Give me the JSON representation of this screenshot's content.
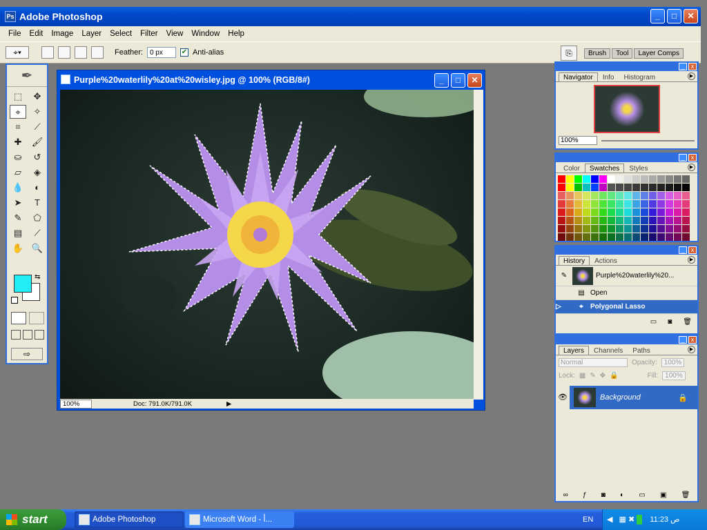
{
  "app": {
    "title": "Adobe Photoshop",
    "icon": "photoshop-icon"
  },
  "window_buttons": {
    "minimize": "_",
    "maximize": "□",
    "close": "✕"
  },
  "menu": [
    "File",
    "Edit",
    "Image",
    "Layer",
    "Select",
    "Filter",
    "View",
    "Window",
    "Help"
  ],
  "options": {
    "feather_label": "Feather:",
    "feather_value": "0 px",
    "antialias_label": "Anti-alias",
    "antialias_checked": true
  },
  "palette_well": [
    "Brush",
    "Tool",
    "Layer Comps"
  ],
  "document": {
    "title": "Purple%20waterlily%20at%20wisley.jpg @ 100% (RGB/8#)",
    "zoom": "100%",
    "doc_size": "Doc: 791.0K/791.0K"
  },
  "foreground_color": "#22ecf5",
  "navigator": {
    "tabs": [
      "Navigator",
      "Info",
      "Histogram"
    ],
    "zoom": "100%"
  },
  "color_panel": {
    "tabs": [
      "Color",
      "Swatches",
      "Styles"
    ]
  },
  "history": {
    "tabs": [
      "History",
      "Actions"
    ],
    "snapshot": "Purple%20waterlily%20...",
    "items": [
      "Open",
      "Polygonal Lasso"
    ]
  },
  "layers": {
    "tabs": [
      "Layers",
      "Channels",
      "Paths"
    ],
    "blend_mode": "Normal",
    "opacity_label": "Opacity:",
    "opacity_value": "100%",
    "lock_label": "Lock:",
    "fill_label": "Fill:",
    "fill_value": "100%",
    "layer_name": "Background"
  },
  "taskbar": {
    "start": "start",
    "tasks": [
      "Adobe Photoshop",
      "Microsoft Word - أ..."
    ],
    "lang": "EN",
    "clock": "11:23 ص"
  }
}
